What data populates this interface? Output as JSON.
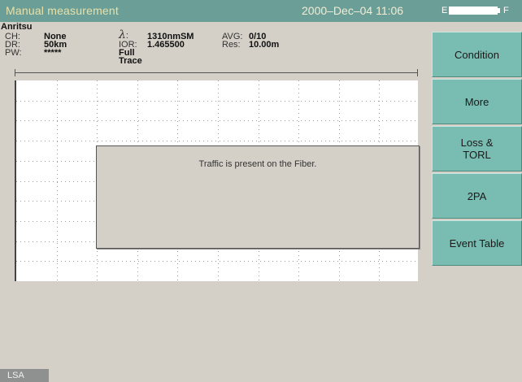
{
  "title_bar": {
    "title": "Manual measurement",
    "datetime": "2000–Dec–04 11:06",
    "battery_empty_label": "E",
    "battery_full_label": "F",
    "battery_level": 1.0
  },
  "brand": "Anritsu",
  "info": {
    "ch_label": "CH:",
    "ch_value": "None",
    "dr_label": "DR:",
    "dr_value": "50km",
    "pw_label": "PW:",
    "pw_value": "*****",
    "lambda_label": ":",
    "lambda_value": "1310nmSM",
    "ior_label": "IOR:",
    "ior_value": "1.465500",
    "trace_value": "Full Trace",
    "avg_label": "AVG:",
    "avg_value": "0/10",
    "res_label": "Res:",
    "res_value": "10.00m"
  },
  "dialog": {
    "message": "Traffic is present on the Fiber."
  },
  "side_buttons": {
    "condition": "Condition",
    "more": "More",
    "loss_torl": "Loss &\nTORL",
    "twopa": "2PA",
    "event_table": "Event Table"
  },
  "status": "LSA",
  "colors": {
    "title_bar": "#6b9e97",
    "button": "#79bcb1",
    "background": "#d4d0c8"
  }
}
